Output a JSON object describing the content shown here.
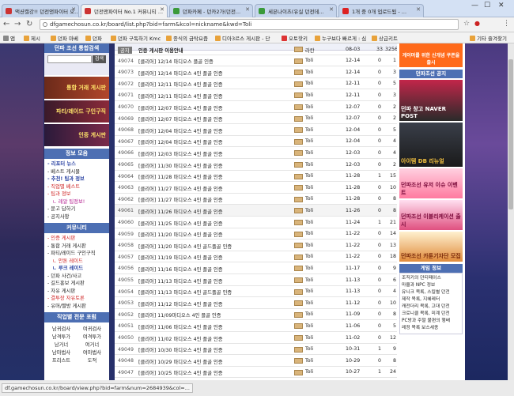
{
  "tabs": [
    {
      "title": "액션캘강!! 던전앤파이터 오..."
    },
    {
      "title": "던전앤파이터 No.1 커뮤니티 ..."
    },
    {
      "title": "던파카페 - 던카2가(던전..."
    },
    {
      "title": "세븐나이츠(유실 던전데..."
    },
    {
      "title": "1개 중 0개 업로드됨 - ..."
    }
  ],
  "address": {
    "url": "dfgamechosun.co.kr/board/list.php?bid=farm&kcol=nickname&kwd=Toli"
  },
  "bookmarks": [
    {
      "label": "앱"
    },
    {
      "label": "제시"
    },
    {
      "label": "던파 마베"
    },
    {
      "label": "던파"
    },
    {
      "label": "던파 구독하기 Kmc"
    },
    {
      "label": "종식의 금탁요즘"
    },
    {
      "label": "디아3르스 게시판 - 단"
    },
    {
      "label": "오토핫키"
    },
    {
      "label": "누구보다 빠르게 : 심"
    },
    {
      "label": "상급키트"
    },
    {
      "label": "기타 즐겨찾기"
    }
  ],
  "left": {
    "search_title": "던파 조선 통합검색",
    "search_button": "검색",
    "banners": [
      {
        "label": "통합 거래 게시판"
      },
      {
        "label": "파티/레이드 구인구직"
      },
      {
        "label": "인증 게시판"
      }
    ],
    "info_title": "정보 모음",
    "info_links": [
      {
        "label": "- 리포터 뉴스"
      },
      {
        "label": "- 베스트 게시물"
      },
      {
        "label": "- 추천! 팁과 정보"
      },
      {
        "label": "- 직업별 베스트"
      },
      {
        "label": "- 팁과 정보"
      },
      {
        "label": "ㄴ 레알 팁정보!"
      },
      {
        "label": "- 묻고 답하기"
      },
      {
        "label": "- 공지사항"
      }
    ],
    "community_title": "커뮤니티",
    "community_links": [
      {
        "label": "- 인증 게시판"
      },
      {
        "label": "- 통합 거래 게시판"
      },
      {
        "label": "- 파티/레이드 구인구직"
      },
      {
        "label": "ㄴ 안톤 레이드"
      },
      {
        "label": "ㄴ 루크 레이드"
      },
      {
        "label": "- 던파 사건/사고"
      },
      {
        "label": "- 길드홍보 게시판"
      },
      {
        "label": "- 자유 게시판"
      },
      {
        "label": "- 결투장 자유토론"
      },
      {
        "label": "- 유머/짤방 게시판"
      }
    ],
    "job_title": "직업별 전문 포럼",
    "jobs": [
      "남귀검사",
      "여귀검사",
      "남격투가",
      "여격투가",
      "남거너",
      "여거너",
      "남마법사",
      "여마법사",
      "프리스트",
      "도적"
    ]
  },
  "board": {
    "notice": {
      "num": "",
      "title": "인증 게시판 이용안내",
      "author": "라칸",
      "date": "08-03",
      "v1": "33",
      "v2": "3256"
    },
    "rows": [
      {
        "num": "49074",
        "title": "[클리어] 12/14 마디오스 플골 인증",
        "author": "Toli",
        "date": "12-14",
        "v1": "0",
        "v2": "1"
      },
      {
        "num": "49073",
        "title": "[클리어] 12/14 마디오스 4인 플골 인증",
        "author": "Toli",
        "date": "12-14",
        "v1": "0",
        "v2": "3"
      },
      {
        "num": "49072",
        "title": "[클리어] 12/11 마디오스 4인 플골 인증",
        "author": "Toli",
        "date": "12-11",
        "v1": "0",
        "v2": "5"
      },
      {
        "num": "49071",
        "title": "[클리어] 12/11 마디오스 4인 플골 인증",
        "author": "Toli",
        "date": "12-11",
        "v1": "0",
        "v2": "3"
      },
      {
        "num": "49070",
        "title": "[클리어] 12/07 마디오스 4인 플골 인증",
        "author": "Toli",
        "date": "12-07",
        "v1": "0",
        "v2": "2"
      },
      {
        "num": "49069",
        "title": "[클리어] 12/07 마디오스 4인 플골 인증",
        "author": "Toli",
        "date": "12-07",
        "v1": "0",
        "v2": "2"
      },
      {
        "num": "49068",
        "title": "[클리어] 12/04 마디오스 4인 플골 인증",
        "author": "Toli",
        "date": "12-04",
        "v1": "0",
        "v2": "5"
      },
      {
        "num": "49067",
        "title": "[클리어] 12/04 마디오스 4인 플골 인증",
        "author": "Toli",
        "date": "12-04",
        "v1": "0",
        "v2": "4"
      },
      {
        "num": "49066",
        "title": "[클리어] 12/03 마디오스 4인 플골 인증",
        "author": "Toli",
        "date": "12-03",
        "v1": "0",
        "v2": "4"
      },
      {
        "num": "49065",
        "title": "[클리어] 11/30 마디오스 4인 플골 인증",
        "author": "Toli",
        "date": "12-03",
        "v1": "0",
        "v2": "2"
      },
      {
        "num": "49064",
        "title": "[클리어] 11/28 마디오스 4인 플골 인증",
        "author": "Toli",
        "date": "11-28",
        "v1": "1",
        "v2": "15"
      },
      {
        "num": "49063",
        "title": "[클리어] 11/27 마디오스 4인 플골 인증",
        "author": "Toli",
        "date": "11-28",
        "v1": "0",
        "v2": "10"
      },
      {
        "num": "49062",
        "title": "[클리어] 11/27 마디오스 4인 플골 인증",
        "author": "Toli",
        "date": "11-28",
        "v1": "0",
        "v2": "8"
      },
      {
        "num": "49061",
        "title": "[클리어] 11/26 마디오스 4인 플골 인증",
        "author": "Toli",
        "date": "11-26",
        "v1": "0",
        "v2": "8"
      },
      {
        "num": "49060",
        "title": "[클리어] 11/25 마디오스 4인 플골 인증",
        "author": "Toli",
        "date": "11-24",
        "v1": "1",
        "v2": "21"
      },
      {
        "num": "49059",
        "title": "[클리어] 11/20 마디오스 4인 플골 인증",
        "author": "Toli",
        "date": "11-22",
        "v1": "0",
        "v2": "14"
      },
      {
        "num": "49058",
        "title": "[클리어] 11/20 마디오스 4인 골드플골 인증",
        "author": "Toli",
        "date": "11-22",
        "v1": "0",
        "v2": "13"
      },
      {
        "num": "49057",
        "title": "[클리어] 11/19 마디오스 4인 플골 인증",
        "author": "Toli",
        "date": "11-22",
        "v1": "0",
        "v2": "18"
      },
      {
        "num": "49056",
        "title": "[클리어] 11/16 마디오스 4인 플골 인증",
        "author": "Toli",
        "date": "11-17",
        "v1": "0",
        "v2": "9"
      },
      {
        "num": "49055",
        "title": "[클리어] 11/13 마디오스 4인 플골 인증",
        "author": "Toli",
        "date": "11-13",
        "v1": "0",
        "v2": "6"
      },
      {
        "num": "49054",
        "title": "[클리어] 11/13 마디오스 4인 골드플골 인증",
        "author": "Toli",
        "date": "11-13",
        "v1": "0",
        "v2": "4"
      },
      {
        "num": "49053",
        "title": "[클리어] 11/12 마디오스 4인 플골 인증",
        "author": "Toli",
        "date": "11-12",
        "v1": "0",
        "v2": "10"
      },
      {
        "num": "49052",
        "title": "[클리어] 11/09마디오스 4인 플골 인증",
        "author": "Toli",
        "date": "11-09",
        "v1": "0",
        "v2": "8"
      },
      {
        "num": "49051",
        "title": "[클리어] 11/06 마디오스 4인 플골 인증",
        "author": "Toli",
        "date": "11-06",
        "v1": "0",
        "v2": "5"
      },
      {
        "num": "49050",
        "title": "[클리어] 11/02 마디오스 4인 플골 인증",
        "author": "Toli",
        "date": "11-02",
        "v1": "0",
        "v2": "12"
      },
      {
        "num": "49049",
        "title": "[클리어] 10/30 마디오스 4인 플골 인증",
        "author": "Toli",
        "date": "10-31",
        "v1": "1",
        "v2": "9"
      },
      {
        "num": "49048",
        "title": "[클리어] 10/29 마디오스 4인 플골 인증",
        "author": "Toli",
        "date": "10-29",
        "v1": "0",
        "v2": "8"
      },
      {
        "num": "49047",
        "title": "[클리어] 10/25 마디오스 4인 플골 인증",
        "author": "Toli",
        "date": "10-27",
        "v1": "1",
        "v2": "24"
      },
      {
        "num": "49045",
        "title": "[클리어] 2016/8/29 마디오스 지봉플 인증",
        "author": "Toli",
        "date": "08-29",
        "v1": "1",
        "v2": "16"
      }
    ]
  },
  "right": {
    "top_banner": "게이머를 위한 신개념 쿠폰을 출시",
    "notice_title": "던파조선 공지",
    "banners": [
      {
        "label": "던파 창고 NAVER POST"
      },
      {
        "label": "아이템 DB 리뉴얼"
      },
      {
        "label": "던파조선 유저 이슈 이벤트"
      },
      {
        "label": "던파조선 이블리케이션 출시"
      },
      {
        "label": "던파조선 카툰기자단 모집"
      }
    ],
    "game_title": "게임 정보",
    "game_links": [
      "조직키의 던티패이스",
      "마을과 NPC 정보",
      "유니크 목록, 스킬별 던전",
      "제작 목록, 지혜레터",
      "캐전더리 목록, 고대 던전",
      "크로니클 목록, 미계 던전",
      "PC방과 주말 불편의 행배",
      "레정 목록 보스세종"
    ]
  },
  "status": {
    "text": "df.gamechosun.co.kr/board/view.php?bid=farm&num=2684939&col=..."
  }
}
